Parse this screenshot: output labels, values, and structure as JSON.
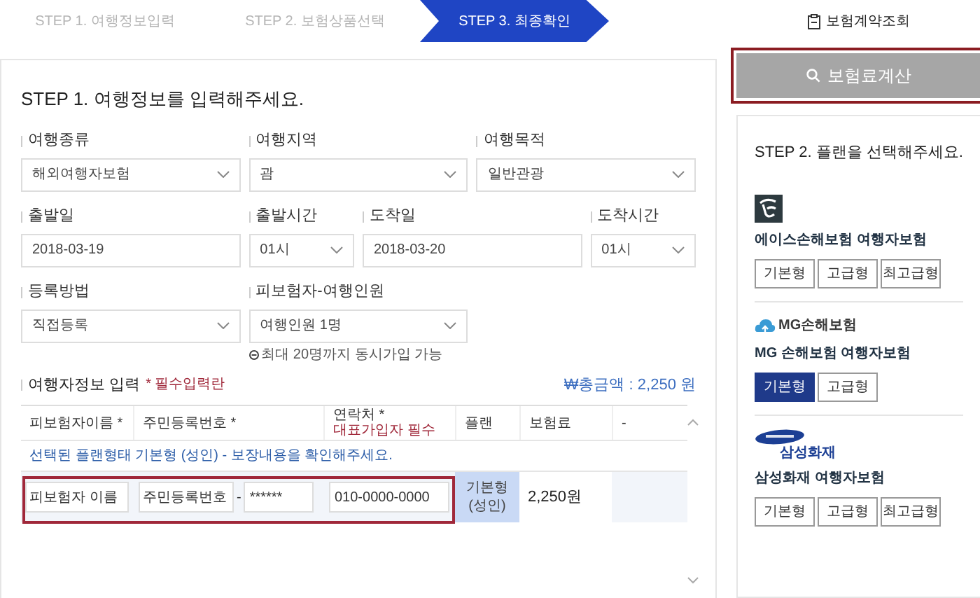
{
  "steps": [
    {
      "label": "STEP 1. 여행정보입력",
      "selected": false
    },
    {
      "label": "STEP 2. 보험상품선택",
      "selected": false
    },
    {
      "label": "STEP 3. 최종확인",
      "selected": true
    }
  ],
  "contract_lookup": "보험계약조회",
  "form": {
    "title": "STEP 1. 여행정보를 입력해주세요.",
    "rows": [
      [
        {
          "label": "여행종류",
          "value": "해외여행자보험",
          "kind": "select"
        },
        {
          "label": "여행지역",
          "value": "괌",
          "kind": "select"
        },
        {
          "label": "여행목적",
          "value": "일반관광",
          "kind": "select"
        }
      ],
      [
        {
          "label": "출발일",
          "value": "2018-03-19",
          "kind": "date"
        },
        {
          "label": "출발시간",
          "value": "01시",
          "kind": "time"
        },
        {
          "label": "도착일",
          "value": "2018-03-20",
          "kind": "date"
        },
        {
          "label": "도착시간",
          "value": "01시",
          "kind": "time"
        }
      ],
      [
        {
          "label": "등록방법",
          "value": "직접등록",
          "kind": "select"
        },
        {
          "label": "피보험자-여행인원",
          "value": "여행인원 1명",
          "kind": "select",
          "hint": "최대 20명까지 동시가입 가능"
        }
      ]
    ]
  },
  "travelers": {
    "title": "여행자정보 입력",
    "required_note": "* 필수입력란",
    "total": "₩총금액 : 2,250 원",
    "columns": [
      {
        "label": "피보험자이름 *"
      },
      {
        "label": "주민등록번호 *"
      },
      {
        "label": "연락처 *",
        "note": "대표가입자 필수"
      },
      {
        "label": "플랜"
      },
      {
        "label": "보험료"
      },
      {
        "label": "-"
      }
    ],
    "notice": "선택된 플랜형태 기본형 (성인) - 보장내용을 확인해주세요.",
    "rows": [
      {
        "name_placeholder": "피보험자 이름",
        "id_front_placeholder": "주민등록번호",
        "id_separator": "-",
        "id_back": "******",
        "phone_placeholder": "010-0000-0000",
        "plan": "기본형 (성인)",
        "premium": "2,250원"
      }
    ]
  },
  "calc_button": "보험료계산",
  "plans_panel": {
    "title": "STEP 2. 플랜을 선택해주세요.",
    "insurers": [
      {
        "kind": "ace",
        "name": "에이스손해보험 여행자보험",
        "plans": [
          {
            "label": "기본형",
            "selected": false
          },
          {
            "label": "고급형",
            "selected": false
          },
          {
            "label": "최고급형",
            "selected": false
          }
        ]
      },
      {
        "kind": "mg",
        "logo_text": "MG손해보험",
        "name": "MG 손해보험 여행자보험",
        "plans": [
          {
            "label": "기본형",
            "selected": true
          },
          {
            "label": "고급형",
            "selected": false
          }
        ]
      },
      {
        "kind": "samsung",
        "logo_text": "삼성화재",
        "name": "삼성화재 여행자보험",
        "plans": [
          {
            "label": "기본형",
            "selected": false
          },
          {
            "label": "고급형",
            "selected": false
          },
          {
            "label": "최고급형",
            "selected": false
          }
        ]
      }
    ]
  }
}
